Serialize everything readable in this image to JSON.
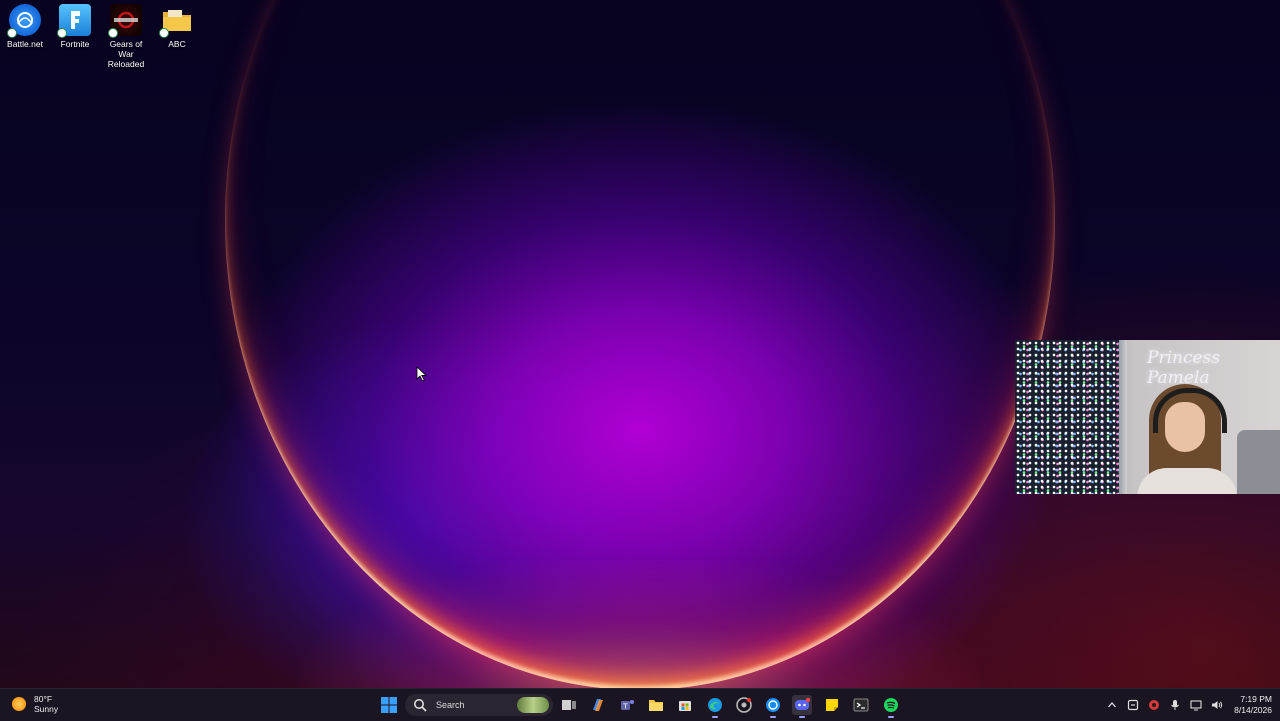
{
  "desktop": {
    "icons": [
      {
        "label": "Battle.net",
        "icon": "battlenet-icon"
      },
      {
        "label": "Fortnite",
        "icon": "fortnite-icon"
      },
      {
        "label": "Gears of War\nReloaded",
        "icon": "gears-of-war-icon"
      },
      {
        "label": "ABC",
        "icon": "folder-icon"
      }
    ]
  },
  "webcam": {
    "overlay_text": "Princess Pamela"
  },
  "taskbar": {
    "weather": {
      "temp": "80°F",
      "condition": "Sunny",
      "icon": "sun-icon"
    },
    "search_label": "Search",
    "pinned": [
      {
        "name": "start-button",
        "icon": "windows-logo-icon"
      },
      {
        "name": "task-view-button",
        "icon": "task-view-icon"
      },
      {
        "name": "copilot-button",
        "icon": "copilot-icon"
      },
      {
        "name": "teams-button",
        "icon": "teams-icon"
      },
      {
        "name": "file-explorer-button",
        "icon": "folder-icon"
      },
      {
        "name": "microsoft-store-button",
        "icon": "store-icon"
      },
      {
        "name": "edge-button",
        "icon": "edge-icon"
      },
      {
        "name": "chrome-button",
        "icon": "chrome-icon"
      },
      {
        "name": "battlenet-taskbar-button",
        "icon": "battlenet-icon"
      },
      {
        "name": "discord-button",
        "icon": "discord-icon"
      },
      {
        "name": "sticky-notes-button",
        "icon": "sticky-notes-icon"
      },
      {
        "name": "terminal-button",
        "icon": "terminal-icon"
      },
      {
        "name": "spotify-button",
        "icon": "spotify-icon"
      }
    ],
    "tray": {
      "icons": [
        "chevron-up-icon",
        "sync-icon",
        "nvidia-icon",
        "microphone-icon",
        "display-icon",
        "speaker-icon"
      ]
    },
    "clock": {
      "time": "7:19 PM",
      "date": "8/14/2026"
    }
  },
  "colors": {
    "taskbar_bg": "#1c1622",
    "accent": "#0078d4",
    "spotify": "#1ed760",
    "discord": "#5865f2"
  }
}
